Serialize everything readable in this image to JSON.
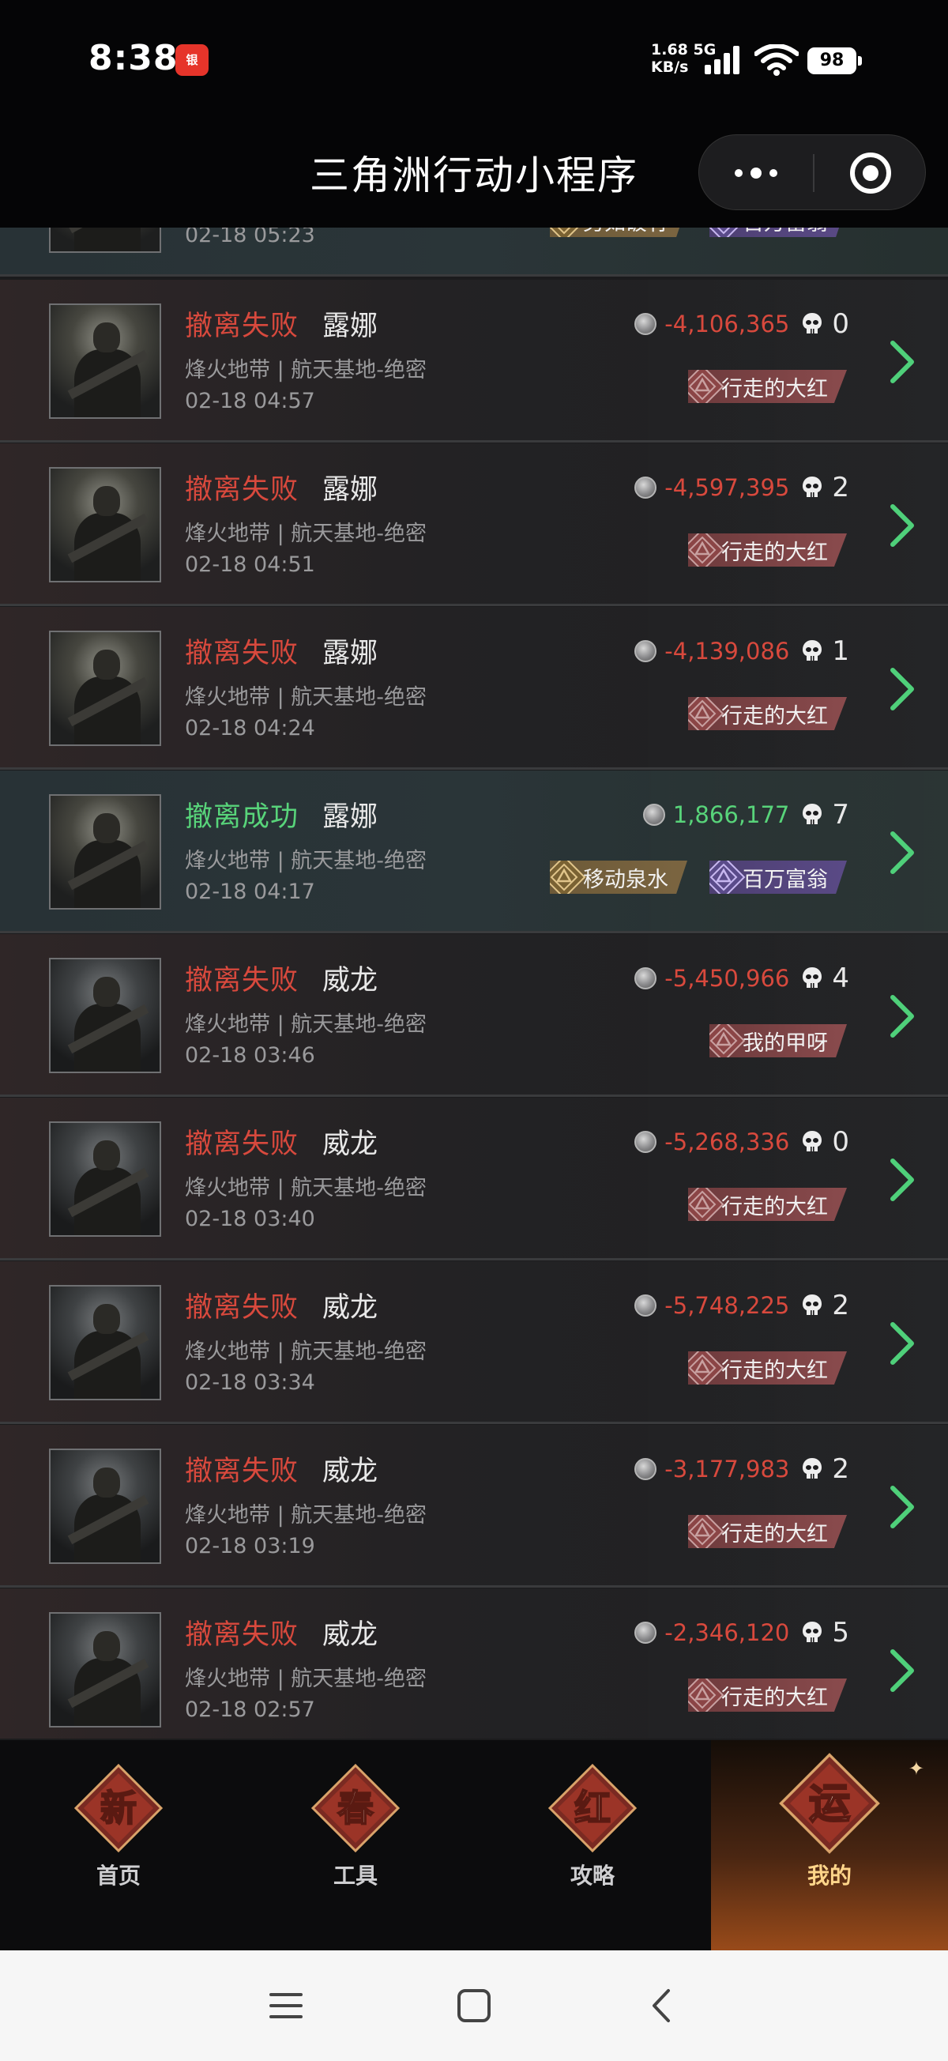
{
  "status_bar": {
    "time": "8:38",
    "net_speed_top": "1.68 5G",
    "net_speed_bottom": "KB/s",
    "battery": "98",
    "notif_icon": "red-app-notification-icon",
    "notif_label": "银"
  },
  "header": {
    "title": "三角洲行动小程序",
    "more_icon": "more-dots-icon",
    "close_icon": "close-circle-icon"
  },
  "partial_row": {
    "time": "02-18 05:23",
    "badges": [
      {
        "label": "势如破竹",
        "style": "gold"
      },
      {
        "label": "百万富翁",
        "style": "purple"
      }
    ]
  },
  "matches": [
    {
      "status": "撤离失败",
      "result": "fail",
      "character": "露娜",
      "map": "烽火地带 | 航天基地-绝密",
      "time": "02-18 04:57",
      "value": "-4,106,365",
      "kills": "0",
      "badges": [
        {
          "label": "行走的大红",
          "style": "red"
        }
      ]
    },
    {
      "status": "撤离失败",
      "result": "fail",
      "character": "露娜",
      "map": "烽火地带 | 航天基地-绝密",
      "time": "02-18 04:51",
      "value": "-4,597,395",
      "kills": "2",
      "badges": [
        {
          "label": "行走的大红",
          "style": "red"
        }
      ]
    },
    {
      "status": "撤离失败",
      "result": "fail",
      "character": "露娜",
      "map": "烽火地带 | 航天基地-绝密",
      "time": "02-18 04:24",
      "value": "-4,139,086",
      "kills": "1",
      "badges": [
        {
          "label": "行走的大红",
          "style": "red"
        }
      ]
    },
    {
      "status": "撤离成功",
      "result": "ok",
      "character": "露娜",
      "map": "烽火地带 | 航天基地-绝密",
      "time": "02-18 04:17",
      "value": "1,866,177",
      "kills": "7",
      "badges": [
        {
          "label": "移动泉水",
          "style": "gold"
        },
        {
          "label": "百万富翁",
          "style": "purple"
        }
      ]
    },
    {
      "status": "撤离失败",
      "result": "fail",
      "character": "威龙",
      "map": "烽火地带 | 航天基地-绝密",
      "time": "02-18 03:46",
      "value": "-5,450,966",
      "kills": "4",
      "badges": [
        {
          "label": "我的甲呀",
          "style": "red"
        }
      ]
    },
    {
      "status": "撤离失败",
      "result": "fail",
      "character": "威龙",
      "map": "烽火地带 | 航天基地-绝密",
      "time": "02-18 03:40",
      "value": "-5,268,336",
      "kills": "0",
      "badges": [
        {
          "label": "行走的大红",
          "style": "red"
        }
      ]
    },
    {
      "status": "撤离失败",
      "result": "fail",
      "character": "威龙",
      "map": "烽火地带 | 航天基地-绝密",
      "time": "02-18 03:34",
      "value": "-5,748,225",
      "kills": "2",
      "badges": [
        {
          "label": "行走的大红",
          "style": "red"
        }
      ]
    },
    {
      "status": "撤离失败",
      "result": "fail",
      "character": "威龙",
      "map": "烽火地带 | 航天基地-绝密",
      "time": "02-18 03:19",
      "value": "-3,177,983",
      "kills": "2",
      "badges": [
        {
          "label": "行走的大红",
          "style": "red"
        }
      ]
    },
    {
      "status": "撤离失败",
      "result": "fail",
      "character": "威龙",
      "map": "烽火地带 | 航天基地-绝密",
      "time": "02-18 02:57",
      "value": "-2,346,120",
      "kills": "5",
      "badges": [
        {
          "label": "行走的大红",
          "style": "red"
        }
      ]
    }
  ],
  "tabs": [
    {
      "label": "首页",
      "glyph": "新",
      "active": false
    },
    {
      "label": "工具",
      "glyph": "春",
      "active": false
    },
    {
      "label": "攻略",
      "glyph": "红",
      "active": false
    },
    {
      "label": "我的",
      "glyph": "运",
      "active": true
    }
  ],
  "colors": {
    "fail": "#d8493d",
    "success": "#58d47a",
    "accent_active_tab": "#ffd58a"
  },
  "nav": {
    "menu_icon": "menu-icon",
    "home_icon": "home-square-icon",
    "back_icon": "back-chevron-icon"
  }
}
